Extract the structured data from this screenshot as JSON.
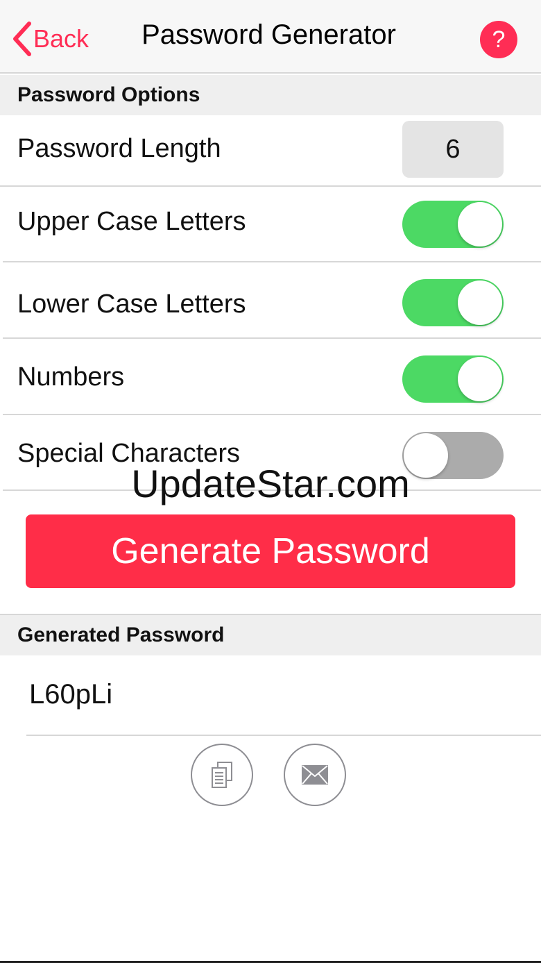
{
  "navbar": {
    "back_label": "Back",
    "title": "Password Generator",
    "help_label": "?"
  },
  "options": {
    "header": "Password Options",
    "length_label": "Password Length",
    "length_value": "6",
    "toggles": [
      {
        "label": "Upper Case Letters",
        "on": true
      },
      {
        "label": "Lower Case Letters",
        "on": true
      },
      {
        "label": "Numbers",
        "on": true
      },
      {
        "label": "Special Characters",
        "on": false
      }
    ]
  },
  "watermark": "UpdateStar.com",
  "generate_button": "Generate Password",
  "result": {
    "header": "Generated Password",
    "value": "L60pLi"
  },
  "actions": {
    "copy_icon": "copy-icon",
    "email_icon": "envelope-icon"
  },
  "colors": {
    "accent": "#ff2d55",
    "toggle_on": "#4cd964",
    "toggle_off": "#ababab",
    "button": "#ff2d48"
  }
}
